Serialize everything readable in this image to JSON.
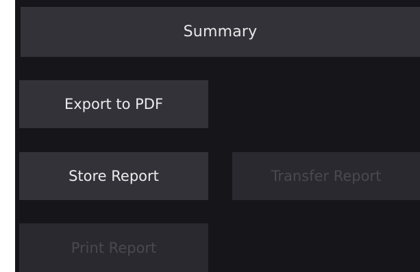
{
  "header": {
    "title": "Summary"
  },
  "buttons": {
    "export_pdf": "Export to PDF",
    "store_report": "Store Report",
    "transfer_report": "Transfer Report",
    "print_report": "Print Report"
  }
}
